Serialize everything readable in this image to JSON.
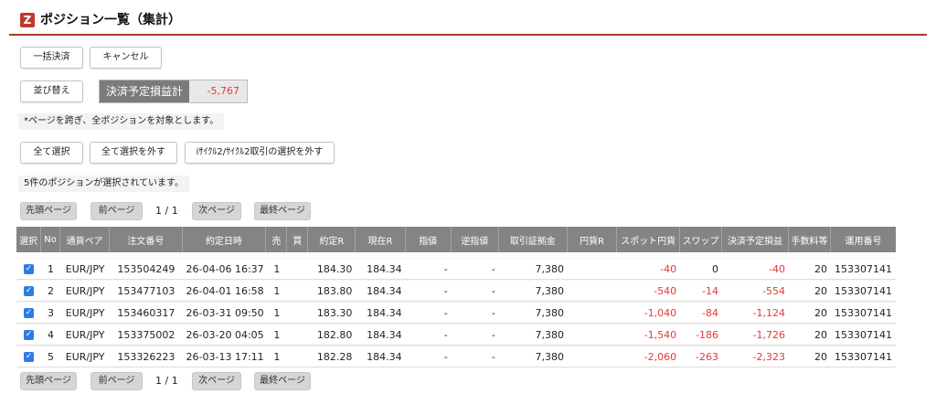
{
  "header": {
    "logo": "Z",
    "title": "ポジション一覧（集計）"
  },
  "actions": {
    "bulk_settle": "一括決済",
    "cancel": "キャンセル",
    "sort": "並び替え",
    "pl_label": "決済予定損益計",
    "pl_value": "-5,767"
  },
  "note": "*ページを跨ぎ、全ポジションを対象とします。",
  "selection": {
    "select_all": "全て選択",
    "deselect_all": "全て選択を外す",
    "deselect_cycle": "iｻｲｸﾙ2/ｻｲｸﾙ2取引の選択を外す",
    "status": "5件のポジションが選択されています。"
  },
  "pager": {
    "first": "先頭ページ",
    "prev": "前ページ",
    "info": "1 / 1",
    "next": "次ページ",
    "last": "最終ページ"
  },
  "table": {
    "headers": [
      "選択",
      "No",
      "通貨ペア",
      "注文番号",
      "約定日時",
      "売",
      "買",
      "約定R",
      "現在R",
      "指値",
      "逆指値",
      "取引証拠金",
      "円貨R",
      "スポット円貨",
      "スワップ",
      "決済予定損益",
      "手数料等",
      "運用番号"
    ],
    "rows": [
      {
        "no": "1",
        "pair": "EUR/JPY",
        "order": "153504249",
        "time": "26-04-06 16:37",
        "sell": "1",
        "buy": "",
        "rate": "184.30",
        "cur": "184.34",
        "limit": "-",
        "stop": "-",
        "margin": "7,380",
        "yen": "",
        "spot": "-40",
        "swap": "0",
        "pl": "-40",
        "fee": "20",
        "op": "153307141"
      },
      {
        "no": "2",
        "pair": "EUR/JPY",
        "order": "153477103",
        "time": "26-04-01 16:58",
        "sell": "1",
        "buy": "",
        "rate": "183.80",
        "cur": "184.34",
        "limit": "-",
        "stop": "-",
        "margin": "7,380",
        "yen": "",
        "spot": "-540",
        "swap": "-14",
        "pl": "-554",
        "fee": "20",
        "op": "153307141"
      },
      {
        "no": "3",
        "pair": "EUR/JPY",
        "order": "153460317",
        "time": "26-03-31 09:50",
        "sell": "1",
        "buy": "",
        "rate": "183.30",
        "cur": "184.34",
        "limit": "-",
        "stop": "-",
        "margin": "7,380",
        "yen": "",
        "spot": "-1,040",
        "swap": "-84",
        "pl": "-1,124",
        "fee": "20",
        "op": "153307141"
      },
      {
        "no": "4",
        "pair": "EUR/JPY",
        "order": "153375002",
        "time": "26-03-20 04:05",
        "sell": "1",
        "buy": "",
        "rate": "182.80",
        "cur": "184.34",
        "limit": "-",
        "stop": "-",
        "margin": "7,380",
        "yen": "",
        "spot": "-1,540",
        "swap": "-186",
        "pl": "-1,726",
        "fee": "20",
        "op": "153307141"
      },
      {
        "no": "5",
        "pair": "EUR/JPY",
        "order": "153326223",
        "time": "26-03-13 17:11",
        "sell": "1",
        "buy": "",
        "rate": "182.28",
        "cur": "184.34",
        "limit": "-",
        "stop": "-",
        "margin": "7,380",
        "yen": "",
        "spot": "-2,060",
        "swap": "-263",
        "pl": "-2,323",
        "fee": "20",
        "op": "153307141"
      }
    ]
  },
  "colors": {
    "accent": "#a83a2e",
    "negative": "#e53935",
    "checkbox": "#2f7be5",
    "header_bg": "#848484"
  }
}
